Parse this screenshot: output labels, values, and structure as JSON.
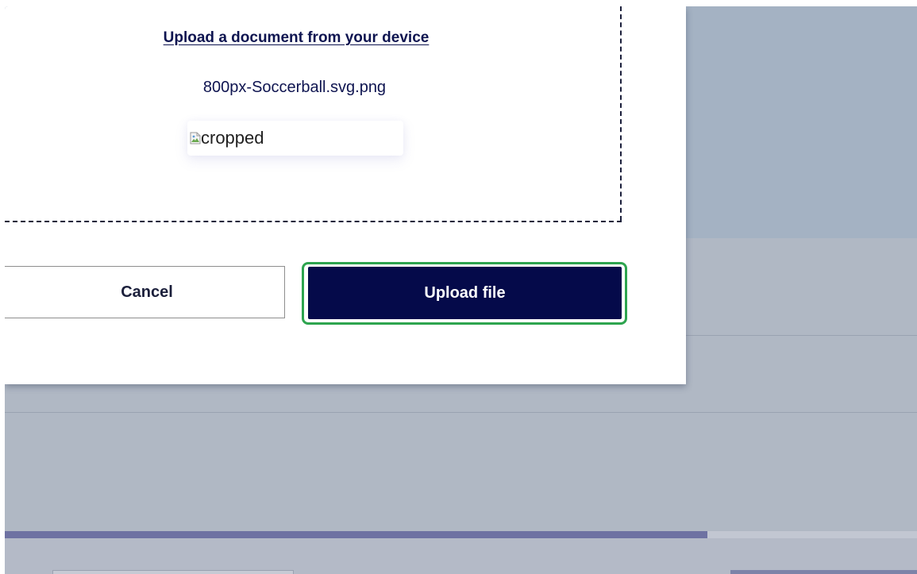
{
  "dialog": {
    "upload_link": "Upload a document from your device",
    "selected_file_name": "800px-Soccerball.svg.png",
    "preview_alt_text": "cropped",
    "cancel_label": "Cancel",
    "upload_label": "Upload file"
  },
  "progress": {
    "fraction": 0.77
  },
  "colors": {
    "primary": "#050a4a",
    "focus_outline": "#2ea44f",
    "text_navy": "#0e1450",
    "progress_fill": "#6e72a2"
  },
  "icons": {
    "preview": "broken-image-icon"
  }
}
